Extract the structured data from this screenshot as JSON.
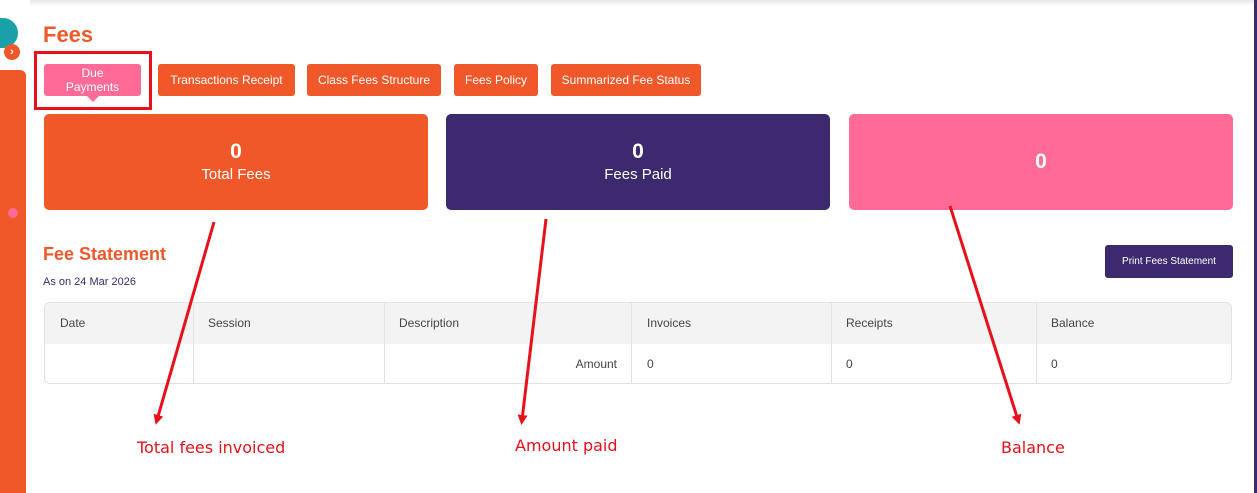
{
  "page": {
    "title": "Fees"
  },
  "tabs": [
    {
      "label": "Due Payments",
      "active": true
    },
    {
      "label": "Transactions Receipt",
      "active": false
    },
    {
      "label": "Class Fees Structure",
      "active": false
    },
    {
      "label": "Fees Policy",
      "active": false
    },
    {
      "label": "Summarized Fee Status",
      "active": false
    }
  ],
  "cards": {
    "total": {
      "value": "0",
      "label": "Total Fees"
    },
    "paid": {
      "value": "0",
      "label": "Fees Paid"
    },
    "balance": {
      "value": "0"
    }
  },
  "statement": {
    "title": "Fee Statement",
    "as_on": "As on 24 Mar 2026",
    "print_label": "Print Fees Statement",
    "columns": [
      "Date",
      "Session",
      "Description",
      "Invoices",
      "Receipts",
      "Balance"
    ],
    "row": {
      "label": "Amount",
      "invoices": "0",
      "receipts": "0",
      "balance": "0"
    }
  },
  "annotations": {
    "total": "Total fees invoiced",
    "paid": "Amount paid",
    "balance": "Balance"
  },
  "colors": {
    "orange": "#f0582a",
    "purple": "#3d2a6e",
    "pink": "#ff6b96",
    "annotation_red": "#e8101a"
  },
  "icons": {
    "sidebar_toggle": "chevron-right-icon"
  }
}
